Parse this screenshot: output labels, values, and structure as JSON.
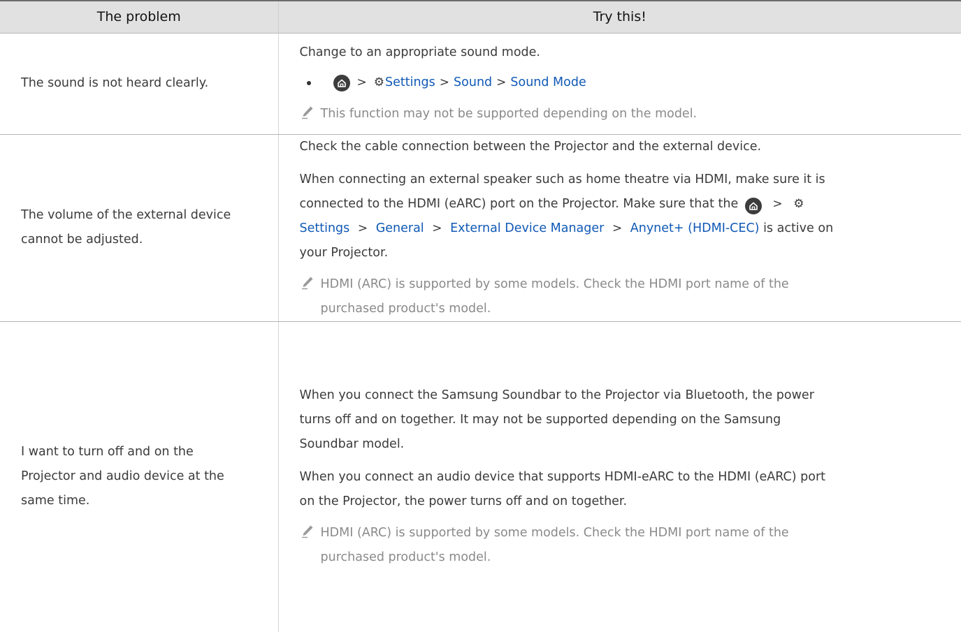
{
  "header": {
    "col1": "The problem",
    "col2": "Try this!"
  },
  "rows": [
    {
      "problem": "The sound is not heard clearly.",
      "text1": "Change to an appropriate sound mode.",
      "path": {
        "settings": "Settings",
        "sound": "Sound",
        "sound_mode": "Sound Mode"
      },
      "note": "This function may not be supported depending on the model."
    },
    {
      "problem_lines": [
        "The volume of the external device",
        "cannot be adjusted."
      ],
      "text1": "Check the cable connection between the Projector and the external device.",
      "text2_line1": "When connecting an external speaker such as home theatre via HDMI, make sure it is",
      "text2_line2": "connected to the HDMI (eARC) port on the Projector. Make sure that the",
      "path": {
        "settings": "Settings",
        "general": "General",
        "edm": "External Device Manager",
        "anynet": "Anynet+ (HDMI-CEC)"
      },
      "text2_tail": " is active on",
      "text2_last": "your Projector.",
      "note_lines": [
        "HDMI (ARC) is supported by some models. Check the HDMI port name of the",
        "purchased product's model."
      ]
    },
    {
      "problem_lines": [
        "I want to turn off and on the",
        "Projector and audio device at the",
        "same time."
      ],
      "text1_lines": [
        "When you connect the Samsung Soundbar to the Projector via Bluetooth, the power",
        "turns off and on together. It may not be supported depending on the Samsung",
        "Soundbar model."
      ],
      "text2_lines": [
        "When you connect an audio device that supports HDMI-eARC to the HDMI (eARC) port",
        "on the Projector, the power turns off and on together."
      ],
      "note_lines": [
        "HDMI (ARC) is supported by some models. Check the HDMI port name of the",
        "purchased product's model."
      ]
    }
  ],
  "icons": {
    "home": "home-icon",
    "settings": "gear-icon",
    "note": "pencil-icon",
    "separator": ">"
  },
  "colors": {
    "link": "#1059b6",
    "header_bg": "#e1e1e1",
    "note_text": "#8a8a8a"
  }
}
